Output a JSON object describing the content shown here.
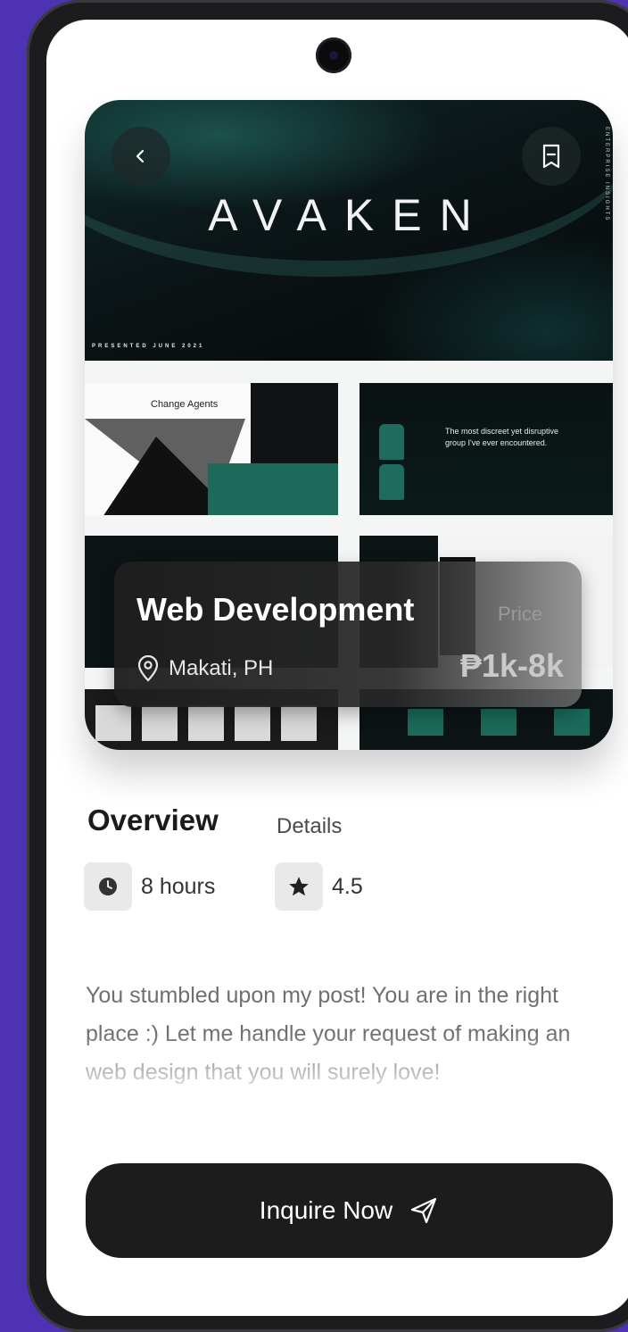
{
  "hero": {
    "brand_text": "AVAKEN",
    "presented_text": "PRESENTED JUNE 2021",
    "vertical_text": "ENTERPRISE INSIGHTS",
    "thumb1_title": "Change Agents",
    "thumb2_quote": "The most discreet yet disruptive group I've ever encountered.",
    "thumb_brand": "AVAKEN"
  },
  "card": {
    "title": "Web Development",
    "location": "Makati, PH",
    "price_label": "Price",
    "price": "₱1k-8k"
  },
  "tabs": {
    "overview": "Overview",
    "details": "Details"
  },
  "meta": {
    "duration": "8 hours",
    "rating": "4.5"
  },
  "description": "You stumbled upon my post! You are in the right place :) Let me handle your request of making an web design that you will surely love!",
  "cta": {
    "label": "Inquire Now"
  },
  "colors": {
    "background": "#4d33b3",
    "accent_green": "#1b6a5a",
    "button": "#1c1c1c"
  }
}
